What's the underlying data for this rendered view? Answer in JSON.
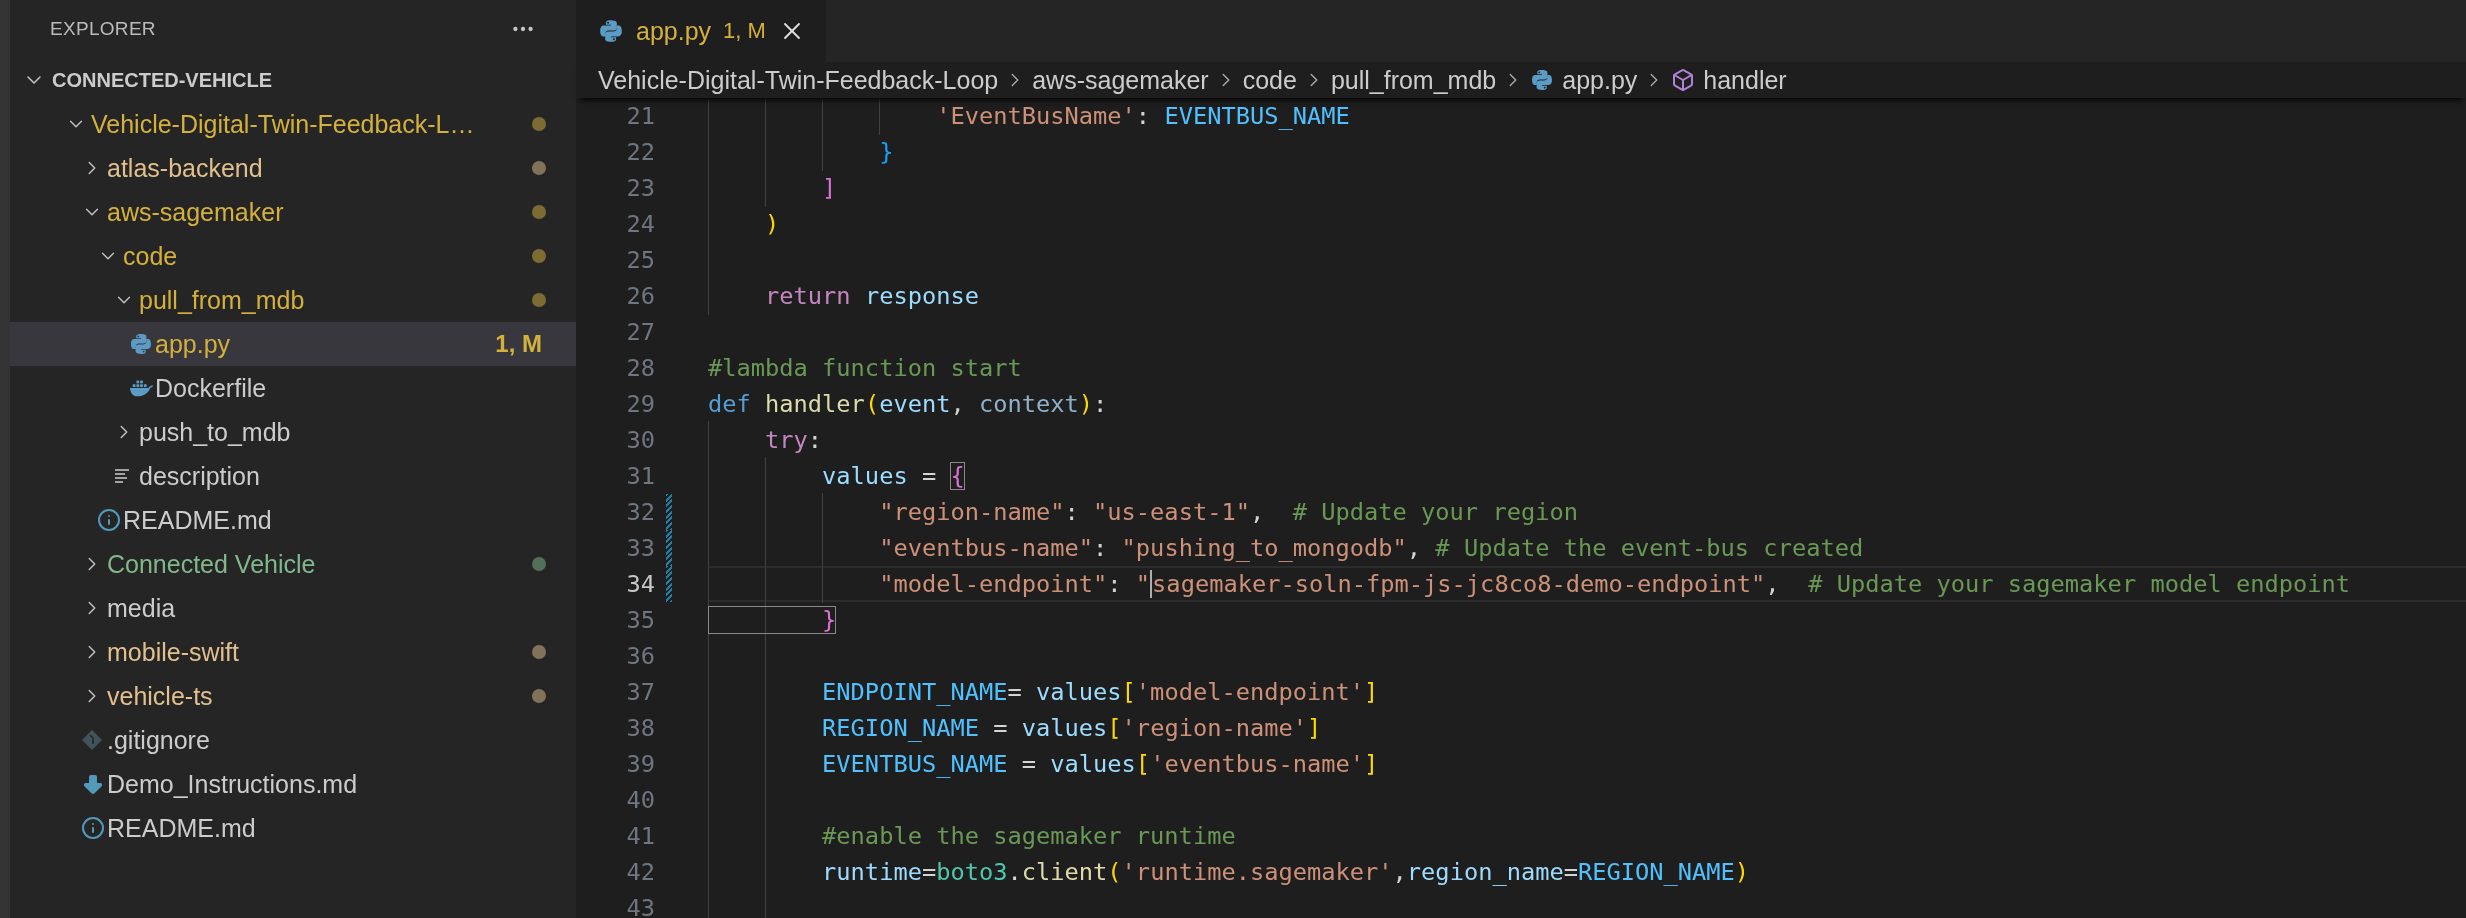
{
  "sidebar": {
    "title": "EXPLORER",
    "root": {
      "label": "CONNECTED-VEHICLE",
      "expanded": true
    },
    "items": [
      {
        "label": "Vehicle-Digital-Twin-Feedback-L…",
        "kind": "folder",
        "expanded": true,
        "selected": false,
        "color": "#d5b13b",
        "decorated": true,
        "children": [
          {
            "label": "atlas-backend",
            "kind": "folder",
            "expanded": false,
            "selected": false,
            "color": "#e2c08d",
            "decorated": true
          },
          {
            "label": "aws-sagemaker",
            "kind": "folder",
            "expanded": true,
            "selected": false,
            "color": "#d5b13b",
            "decorated": true,
            "children": [
              {
                "label": "code",
                "kind": "folder",
                "expanded": true,
                "selected": false,
                "color": "#d5b13b",
                "decorated": true,
                "children": [
                  {
                    "label": "pull_from_mdb",
                    "kind": "folder",
                    "expanded": true,
                    "selected": false,
                    "color": "#d5b13b",
                    "decorated": true,
                    "children": [
                      {
                        "label": "app.py",
                        "kind": "python",
                        "selected": true,
                        "color": "#d5b13b",
                        "decorated": false,
                        "badge": "1, M"
                      },
                      {
                        "label": "Dockerfile",
                        "kind": "docker",
                        "selected": false,
                        "decorated": false
                      }
                    ]
                  },
                  {
                    "label": "push_to_mdb",
                    "kind": "folder",
                    "expanded": false,
                    "selected": false,
                    "decorated": false
                  },
                  {
                    "label": "description",
                    "kind": "text",
                    "selected": false,
                    "decorated": false
                  }
                ]
              },
              {
                "label": "README.md",
                "kind": "info",
                "selected": false,
                "decorated": false
              }
            ]
          },
          {
            "label": "Connected Vehicle",
            "kind": "folder",
            "expanded": false,
            "selected": false,
            "color": "#81b88b",
            "decorated": true
          },
          {
            "label": "media",
            "kind": "folder",
            "expanded": false,
            "selected": false,
            "decorated": false
          },
          {
            "label": "mobile-swift",
            "kind": "folder",
            "expanded": false,
            "selected": false,
            "color": "#e2c08d",
            "decorated": true
          },
          {
            "label": "vehicle-ts",
            "kind": "folder",
            "expanded": false,
            "selected": false,
            "color": "#e2c08d",
            "decorated": true
          },
          {
            "label": ".gitignore",
            "kind": "git",
            "selected": false,
            "decorated": false
          },
          {
            "label": "Demo_Instructions.md",
            "kind": "download",
            "selected": false,
            "decorated": false
          },
          {
            "label": "README.md",
            "kind": "info",
            "selected": false,
            "decorated": false
          }
        ]
      }
    ]
  },
  "tabs": [
    {
      "label": "app.py",
      "badge": "1, M",
      "kind": "python",
      "selected": true
    }
  ],
  "breadcrumbs": [
    {
      "label": "Vehicle-Digital-Twin-Feedback-Loop",
      "kind": "folder"
    },
    {
      "label": "aws-sagemaker",
      "kind": "folder"
    },
    {
      "label": "code",
      "kind": "folder"
    },
    {
      "label": "pull_from_mdb",
      "kind": "folder"
    },
    {
      "label": "app.py",
      "kind": "python"
    },
    {
      "label": "handler",
      "kind": "symbol"
    }
  ],
  "editor": {
    "lines": [
      {
        "number": "21",
        "current": false,
        "modified": false,
        "tokens": [
          {
            "kind": "string",
            "text": "                'EventBusName'"
          },
          {
            "kind": "punct",
            "text": ": "
          },
          {
            "kind": "const",
            "text": "EVENTBUS_NAME"
          }
        ]
      },
      {
        "number": "22",
        "current": false,
        "modified": false,
        "tokens": [
          {
            "kind": "bracket3",
            "text": "            }"
          }
        ]
      },
      {
        "number": "23",
        "current": false,
        "modified": false,
        "tokens": [
          {
            "kind": "bracket2",
            "text": "        ]"
          }
        ]
      },
      {
        "number": "24",
        "current": false,
        "modified": false,
        "tokens": [
          {
            "kind": "bracket1",
            "text": "    )"
          }
        ]
      },
      {
        "number": "25",
        "current": false,
        "modified": false
      },
      {
        "number": "26",
        "current": false,
        "modified": false,
        "tokens": [
          {
            "kind": "control",
            "text": "    return "
          },
          {
            "kind": "variable",
            "text": "response"
          }
        ]
      },
      {
        "number": "27",
        "current": false,
        "modified": false
      },
      {
        "number": "28",
        "current": false,
        "modified": false,
        "tokens": [
          {
            "kind": "comment",
            "text": "#lambda function start"
          }
        ]
      },
      {
        "number": "29",
        "current": false,
        "modified": false,
        "tokens": [
          {
            "kind": "keyword",
            "text": "def "
          },
          {
            "kind": "function",
            "text": "handler"
          },
          {
            "kind": "bracket1",
            "text": "("
          },
          {
            "kind": "variable",
            "text": "event"
          },
          {
            "kind": "punct",
            "text": ", "
          },
          {
            "kind": "unused",
            "text": "context"
          },
          {
            "kind": "bracket1",
            "text": ")"
          },
          {
            "kind": "punct",
            "text": ":"
          }
        ]
      },
      {
        "number": "30",
        "current": false,
        "modified": false,
        "tokens": [
          {
            "kind": "control",
            "text": "    try"
          },
          {
            "kind": "punct",
            "text": ":"
          }
        ]
      },
      {
        "number": "31",
        "current": false,
        "modified": false,
        "tokens": [
          {
            "kind": "variable",
            "text": "        values"
          },
          {
            "kind": "punct",
            "text": " = "
          },
          {
            "kind": "bracket2",
            "text": "{",
            "matched": true
          }
        ]
      },
      {
        "number": "32",
        "current": false,
        "modified": true,
        "tokens": [
          {
            "kind": "string",
            "text": "            \"region-name\""
          },
          {
            "kind": "punct",
            "text": ": "
          },
          {
            "kind": "string",
            "text": "\"us-east-1\""
          },
          {
            "kind": "punct",
            "text": ",  "
          },
          {
            "kind": "comment",
            "text": "# Update your region"
          }
        ]
      },
      {
        "number": "33",
        "current": false,
        "modified": true,
        "tokens": [
          {
            "kind": "string",
            "text": "            \"eventbus-name\""
          },
          {
            "kind": "punct",
            "text": ": "
          },
          {
            "kind": "string",
            "text": "\"pushing_to_mongodb\""
          },
          {
            "kind": "punct",
            "text": ", "
          },
          {
            "kind": "comment",
            "text": "# Update the event-bus created"
          }
        ]
      },
      {
        "number": "34",
        "current": true,
        "modified": true,
        "tokens": [
          {
            "kind": "string",
            "text": "            \"model-endpoint\""
          },
          {
            "kind": "punct",
            "text": ": "
          },
          {
            "kind": "string",
            "text": "\""
          },
          {
            "kind": "string",
            "text": "sagemaker-soln-fpm-js-jc8co8-demo-endpoint\"",
            "caret": true
          },
          {
            "kind": "punct",
            "text": ",  "
          },
          {
            "kind": "comment",
            "text": "# Update your sagemaker model endpoint"
          }
        ]
      },
      {
        "number": "35",
        "current": false,
        "modified": false,
        "tokens": [
          {
            "kind": "bracket2",
            "text": "        }",
            "matched": true
          }
        ]
      },
      {
        "number": "36",
        "current": false,
        "modified": false
      },
      {
        "number": "37",
        "current": false,
        "modified": false,
        "tokens": [
          {
            "kind": "const",
            "text": "        ENDPOINT_NAME"
          },
          {
            "kind": "punct",
            "text": "= "
          },
          {
            "kind": "variable",
            "text": "values"
          },
          {
            "kind": "bracket1",
            "text": "["
          },
          {
            "kind": "string",
            "text": "'model-endpoint'"
          },
          {
            "kind": "bracket1",
            "text": "]"
          }
        ]
      },
      {
        "number": "38",
        "current": false,
        "modified": false,
        "tokens": [
          {
            "kind": "const",
            "text": "        REGION_NAME"
          },
          {
            "kind": "punct",
            "text": " = "
          },
          {
            "kind": "variable",
            "text": "values"
          },
          {
            "kind": "bracket1",
            "text": "["
          },
          {
            "kind": "string",
            "text": "'region-name'"
          },
          {
            "kind": "bracket1",
            "text": "]"
          }
        ]
      },
      {
        "number": "39",
        "current": false,
        "modified": false,
        "tokens": [
          {
            "kind": "const",
            "text": "        EVENTBUS_NAME"
          },
          {
            "kind": "punct",
            "text": " = "
          },
          {
            "kind": "variable",
            "text": "values"
          },
          {
            "kind": "bracket1",
            "text": "["
          },
          {
            "kind": "string",
            "text": "'eventbus-name'"
          },
          {
            "kind": "bracket1",
            "text": "]"
          }
        ]
      },
      {
        "number": "40",
        "current": false,
        "modified": false
      },
      {
        "number": "41",
        "current": false,
        "modified": false,
        "tokens": [
          {
            "kind": "comment",
            "text": "        #enable the sagemaker runtime"
          }
        ]
      },
      {
        "number": "42",
        "current": false,
        "modified": false,
        "tokens": [
          {
            "kind": "variable",
            "text": "        runtime"
          },
          {
            "kind": "punct",
            "text": "="
          },
          {
            "kind": "class",
            "text": "boto3"
          },
          {
            "kind": "punct",
            "text": "."
          },
          {
            "kind": "function",
            "text": "client"
          },
          {
            "kind": "bracket1",
            "text": "("
          },
          {
            "kind": "string",
            "text": "'runtime.sagemaker'"
          },
          {
            "kind": "punct",
            "text": ","
          },
          {
            "kind": "variable",
            "text": "region_name"
          },
          {
            "kind": "punct",
            "text": "="
          },
          {
            "kind": "const",
            "text": "REGION_NAME"
          },
          {
            "kind": "bracket1",
            "text": ")"
          }
        ]
      },
      {
        "number": "43",
        "current": false,
        "modified": false
      }
    ]
  }
}
